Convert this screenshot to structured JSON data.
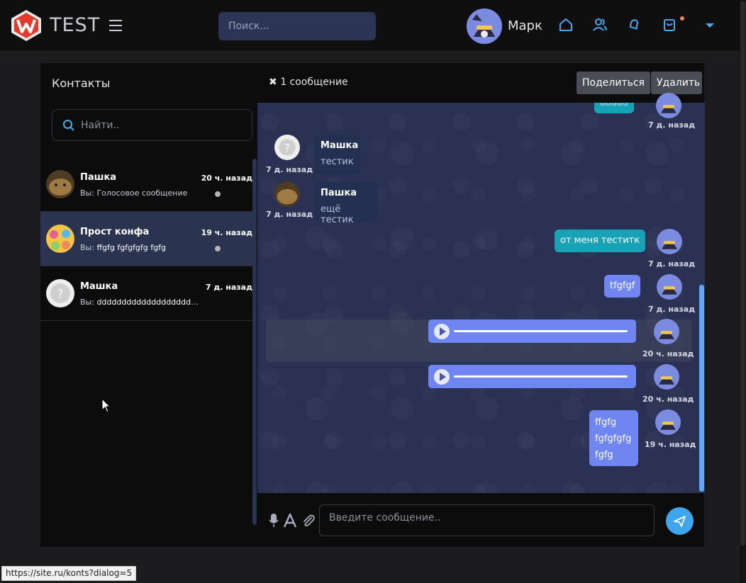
{
  "header": {
    "brand": "TEST",
    "search_placeholder": "Поиск...",
    "user_name": "Марк",
    "nav_icons": [
      "home-icon",
      "users-icon",
      "bell-icon",
      "cart-icon",
      "caret-down-icon"
    ]
  },
  "contacts": {
    "title": "Контакты",
    "search_placeholder": "Найти..",
    "items": [
      {
        "name": "Пашка",
        "time": "20 ч. назад",
        "preview_prefix": "Вы:",
        "preview": "Голосовое сообщение",
        "active": false
      },
      {
        "name": "Прост конфа",
        "time": "19 ч. назад",
        "preview_prefix": "Вы:",
        "preview": "ffgfg fgfgfgfg fgfg",
        "active": true
      },
      {
        "name": "Машка",
        "time": "7 д. назад",
        "preview_prefix": "Вы:",
        "preview": "dddddddddddddddddddddd...",
        "active": false
      }
    ]
  },
  "chat": {
    "selection_text": "1 сообщение",
    "share_label": "Поделиться",
    "delete_label": "Удалить",
    "messages": [
      {
        "direction": "out",
        "text": "aaaaa",
        "time": "7 д. назад"
      },
      {
        "direction": "in",
        "author": "Машка",
        "text": "тестик",
        "time": "7 д. назад"
      },
      {
        "direction": "in",
        "author": "Пашка",
        "text": "ещё тестик",
        "time": "7 д. назад"
      },
      {
        "direction": "out",
        "text": "от меня теститк",
        "time": "7 д. назад"
      },
      {
        "direction": "out",
        "text": "tfgfgf",
        "time": "7 д. назад"
      },
      {
        "direction": "out",
        "type": "audio",
        "time": "20 ч. назад"
      },
      {
        "direction": "out",
        "type": "audio",
        "time": "20 ч. назад"
      },
      {
        "direction": "out",
        "lines": [
          "ffgfg",
          "fgfgfgfg",
          "fgfg"
        ],
        "time": "19 ч. назад"
      }
    ],
    "input_placeholder": "Введите сообщение.."
  },
  "status_bar_url": "https://site.ru/konts?dialog=5",
  "colors": {
    "accent_blue": "#3ea6ec",
    "bubble_teal": "#18a2b5",
    "bubble_blue": "#6f86f2",
    "chat_bg": "#2b3152",
    "active_contact": "#2a3350"
  }
}
